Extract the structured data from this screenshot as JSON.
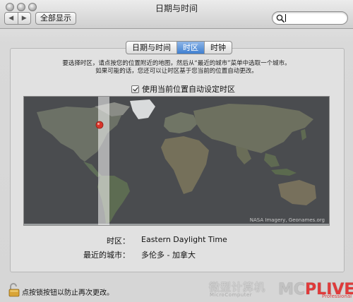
{
  "window": {
    "title": "日期与时间",
    "show_all_label": "全部显示",
    "back_arrow": "◀",
    "forward_arrow": "▶",
    "search_placeholder": ""
  },
  "tabs": [
    {
      "label": "日期与时间",
      "active": false
    },
    {
      "label": "时区",
      "active": true
    },
    {
      "label": "时钟",
      "active": false
    }
  ],
  "instructions": {
    "line1": "要选择时区，请点按您的位置附近的地图，然后从“最近的城市”菜单中选取一个城市。",
    "line2": "如果可能的话，您还可以让时区基于您当前的位置自动更改。"
  },
  "auto_timezone": {
    "label": "使用当前位置自动设定时区",
    "checked": true
  },
  "map": {
    "credit": "NASA Imagery, Geonames.org",
    "pin_color": "#d8352a"
  },
  "timezone": {
    "label": "时区：",
    "value": "Eastern Daylight Time"
  },
  "closest_city": {
    "label": "最近的城市：",
    "value": "多伦多 - 加拿大"
  },
  "lock": {
    "text": "点按锁按钮以防止再次更改。"
  },
  "watermark": {
    "cn": "微型计算机",
    "en": "MicroComputer",
    "logo_a": "MC",
    "logo_b": "PLIVE",
    "pro": "Professional"
  },
  "colors": {
    "tab_active": "#3f7fd0",
    "map_bg": "#4a4c4f"
  }
}
